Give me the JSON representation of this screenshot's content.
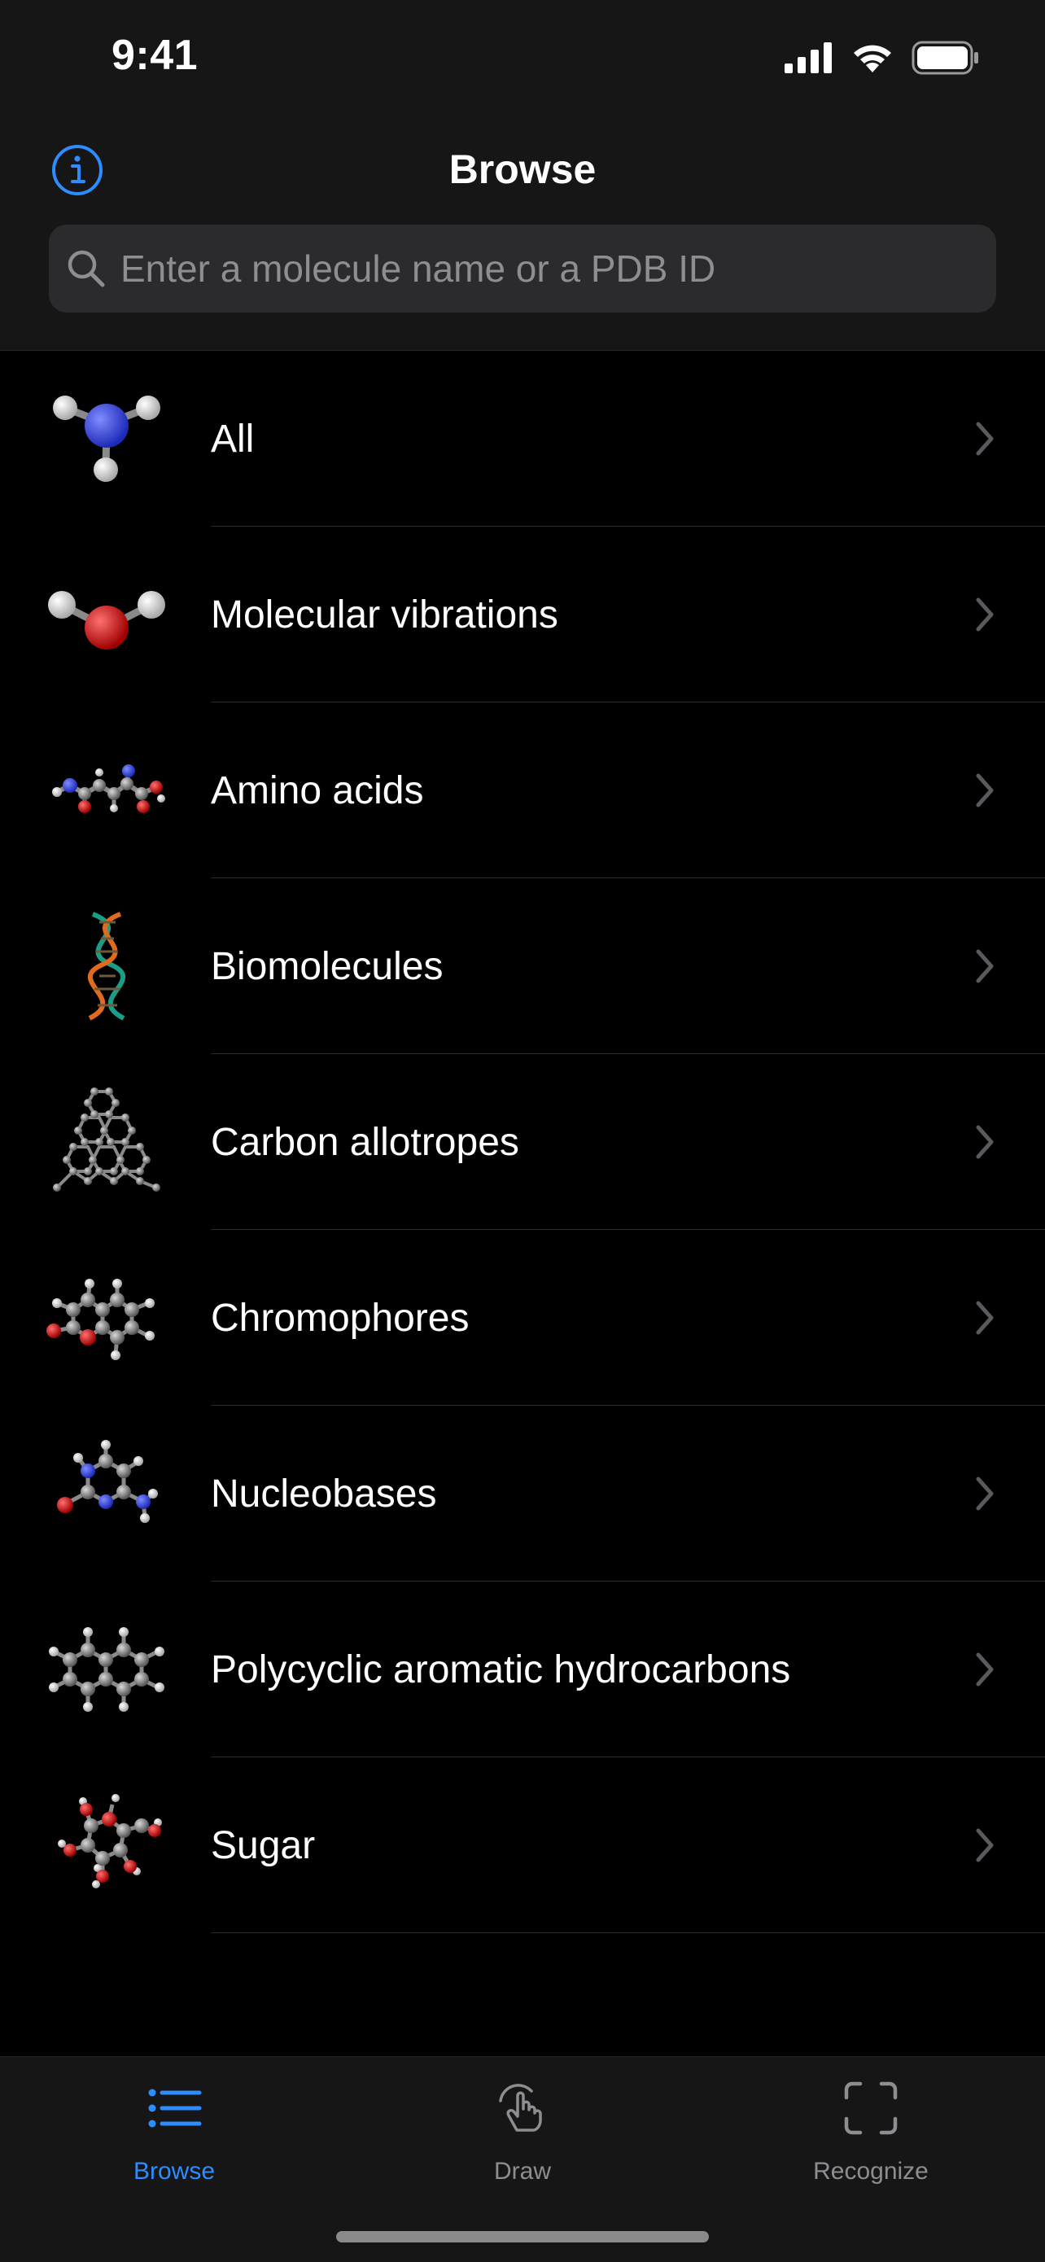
{
  "status": {
    "time": "9:41"
  },
  "nav": {
    "title": "Browse"
  },
  "search": {
    "placeholder": "Enter a molecule name or a PDB ID"
  },
  "categories": [
    {
      "label": "All",
      "icon": "ammonia-molecule-icon"
    },
    {
      "label": "Molecular vibrations",
      "icon": "water-molecule-icon"
    },
    {
      "label": "Amino acids",
      "icon": "amino-acid-molecule-icon"
    },
    {
      "label": "Biomolecules",
      "icon": "dna-helix-icon"
    },
    {
      "label": "Carbon allotropes",
      "icon": "carbon-allotrope-icon"
    },
    {
      "label": "Chromophores",
      "icon": "chromophore-molecule-icon"
    },
    {
      "label": "Nucleobases",
      "icon": "nucleobase-molecule-icon"
    },
    {
      "label": "Polycyclic aromatic hydrocarbons",
      "icon": "naphthalene-molecule-icon"
    },
    {
      "label": "Sugar",
      "icon": "sugar-molecule-icon"
    }
  ],
  "tabs": [
    {
      "label": "Browse",
      "icon": "list-icon",
      "selected": true
    },
    {
      "label": "Draw",
      "icon": "hand-pointer-icon",
      "selected": false
    },
    {
      "label": "Recognize",
      "icon": "scan-frame-icon",
      "selected": false
    }
  ],
  "colors": {
    "accent": "#2d8cff",
    "inactive": "#8d8d92",
    "background": "#000000",
    "bar": "#161616"
  }
}
